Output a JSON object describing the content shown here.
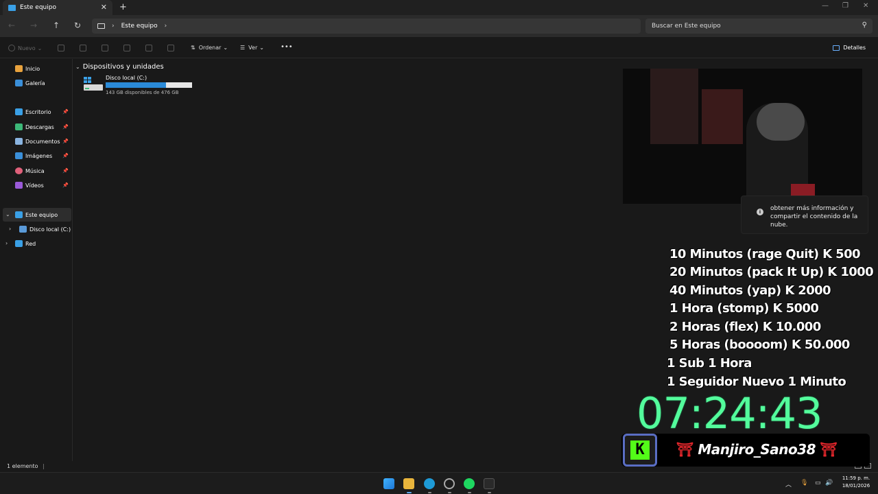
{
  "window": {
    "tab_title": "Este equipo",
    "tab_close": "✕",
    "new_tab": "+",
    "minimize": "—",
    "maximize": "❐",
    "close": "✕"
  },
  "nav": {
    "back": "←",
    "forward": "→",
    "up": "↑",
    "refresh": "↻",
    "breadcrumb_sep": "›",
    "breadcrumb": "Este equipo",
    "breadcrumb_sep2": "›",
    "search_placeholder": "Buscar en Este equipo",
    "search_icon": "⚲"
  },
  "toolbar": {
    "new_label": "Nuevo",
    "sort_label": "Ordenar",
    "view_label": "Ver",
    "more_label": "•••",
    "details_label": "Detalles"
  },
  "sidebar": {
    "items": [
      {
        "label": "Inicio",
        "icon": "home-icon",
        "color": "#e8a23d"
      },
      {
        "label": "Galería",
        "icon": "gallery-icon",
        "color": "#3a8fd9"
      },
      {
        "label": "Escritorio",
        "icon": "desktop-icon",
        "color": "#3aa0e6"
      },
      {
        "label": "Descargas",
        "icon": "download-icon",
        "color": "#3cb878"
      },
      {
        "label": "Documentos",
        "icon": "documents-icon",
        "color": "#8ab4e0"
      },
      {
        "label": "Imágenes",
        "icon": "pictures-icon",
        "color": "#3a8fd9"
      },
      {
        "label": "Música",
        "icon": "music-icon",
        "color": "#e0607a"
      },
      {
        "label": "Vídeos",
        "icon": "videos-icon",
        "color": "#9a5ad8"
      },
      {
        "label": "Este equipo",
        "icon": "pc-icon",
        "color": "#3aa0e6"
      },
      {
        "label": "Disco local (C:)",
        "icon": "drive-icon",
        "color": "#5a9ad8"
      },
      {
        "label": "Red",
        "icon": "network-icon",
        "color": "#3aa0e6"
      }
    ],
    "pin": "📌"
  },
  "main": {
    "group_label": "Dispositivos y unidades",
    "group_chevron": "⌄",
    "drive_name": "Disco local (C:)",
    "drive_free": "143 GB disponibles de 476 GB",
    "drive_used_fraction": 0.7
  },
  "status": {
    "count": "1 elemento"
  },
  "overlay": {
    "info_text": "obtener más información y compartir el contenido de la nube.",
    "info_icon": "i",
    "goals": [
      "10 Minutos (rage Quit) K 500",
      "20 Minutos (pack It Up) K 1000",
      "40 Minutos (yap) K 2000",
      "1 Hora (stomp) K 5000",
      "2 Horas (flex) K 10.000",
      "5 Horas (boooom) K 50.000",
      "1 Sub 1 Hora",
      "1 Seguidor Nuevo 1 Minuto"
    ],
    "timer": "07:24:43",
    "kick_letter": "K",
    "username": "Manjiro_Sano38",
    "torii": "⛩"
  },
  "taskbar": {
    "chevron_up": "︿",
    "time": "11:59 p. m.",
    "date": "18/01/2026"
  }
}
